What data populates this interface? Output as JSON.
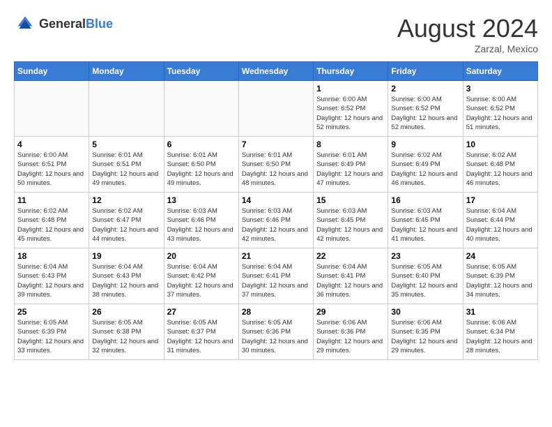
{
  "header": {
    "logo_general": "General",
    "logo_blue": "Blue",
    "month_year": "August 2024",
    "location": "Zarzal, Mexico"
  },
  "days_of_week": [
    "Sunday",
    "Monday",
    "Tuesday",
    "Wednesday",
    "Thursday",
    "Friday",
    "Saturday"
  ],
  "weeks": [
    [
      {
        "day": "",
        "empty": true
      },
      {
        "day": "",
        "empty": true
      },
      {
        "day": "",
        "empty": true
      },
      {
        "day": "",
        "empty": true
      },
      {
        "day": "1",
        "sunrise": "6:00 AM",
        "sunset": "6:52 PM",
        "daylight": "12 hours and 52 minutes."
      },
      {
        "day": "2",
        "sunrise": "6:00 AM",
        "sunset": "6:52 PM",
        "daylight": "12 hours and 52 minutes."
      },
      {
        "day": "3",
        "sunrise": "6:00 AM",
        "sunset": "6:52 PM",
        "daylight": "12 hours and 51 minutes."
      }
    ],
    [
      {
        "day": "4",
        "sunrise": "6:00 AM",
        "sunset": "6:51 PM",
        "daylight": "12 hours and 50 minutes."
      },
      {
        "day": "5",
        "sunrise": "6:01 AM",
        "sunset": "6:51 PM",
        "daylight": "12 hours and 49 minutes."
      },
      {
        "day": "6",
        "sunrise": "6:01 AM",
        "sunset": "6:50 PM",
        "daylight": "12 hours and 49 minutes."
      },
      {
        "day": "7",
        "sunrise": "6:01 AM",
        "sunset": "6:50 PM",
        "daylight": "12 hours and 48 minutes."
      },
      {
        "day": "8",
        "sunrise": "6:01 AM",
        "sunset": "6:49 PM",
        "daylight": "12 hours and 47 minutes."
      },
      {
        "day": "9",
        "sunrise": "6:02 AM",
        "sunset": "6:49 PM",
        "daylight": "12 hours and 46 minutes."
      },
      {
        "day": "10",
        "sunrise": "6:02 AM",
        "sunset": "6:48 PM",
        "daylight": "12 hours and 46 minutes."
      }
    ],
    [
      {
        "day": "11",
        "sunrise": "6:02 AM",
        "sunset": "6:48 PM",
        "daylight": "12 hours and 45 minutes."
      },
      {
        "day": "12",
        "sunrise": "6:02 AM",
        "sunset": "6:47 PM",
        "daylight": "12 hours and 44 minutes."
      },
      {
        "day": "13",
        "sunrise": "6:03 AM",
        "sunset": "6:46 PM",
        "daylight": "12 hours and 43 minutes."
      },
      {
        "day": "14",
        "sunrise": "6:03 AM",
        "sunset": "6:46 PM",
        "daylight": "12 hours and 42 minutes."
      },
      {
        "day": "15",
        "sunrise": "6:03 AM",
        "sunset": "6:45 PM",
        "daylight": "12 hours and 42 minutes."
      },
      {
        "day": "16",
        "sunrise": "6:03 AM",
        "sunset": "6:45 PM",
        "daylight": "12 hours and 41 minutes."
      },
      {
        "day": "17",
        "sunrise": "6:04 AM",
        "sunset": "6:44 PM",
        "daylight": "12 hours and 40 minutes."
      }
    ],
    [
      {
        "day": "18",
        "sunrise": "6:04 AM",
        "sunset": "6:43 PM",
        "daylight": "12 hours and 39 minutes."
      },
      {
        "day": "19",
        "sunrise": "6:04 AM",
        "sunset": "6:43 PM",
        "daylight": "12 hours and 38 minutes."
      },
      {
        "day": "20",
        "sunrise": "6:04 AM",
        "sunset": "6:42 PM",
        "daylight": "12 hours and 37 minutes."
      },
      {
        "day": "21",
        "sunrise": "6:04 AM",
        "sunset": "6:41 PM",
        "daylight": "12 hours and 37 minutes."
      },
      {
        "day": "22",
        "sunrise": "6:04 AM",
        "sunset": "6:41 PM",
        "daylight": "12 hours and 36 minutes."
      },
      {
        "day": "23",
        "sunrise": "6:05 AM",
        "sunset": "6:40 PM",
        "daylight": "12 hours and 35 minutes."
      },
      {
        "day": "24",
        "sunrise": "6:05 AM",
        "sunset": "6:39 PM",
        "daylight": "12 hours and 34 minutes."
      }
    ],
    [
      {
        "day": "25",
        "sunrise": "6:05 AM",
        "sunset": "6:39 PM",
        "daylight": "12 hours and 33 minutes."
      },
      {
        "day": "26",
        "sunrise": "6:05 AM",
        "sunset": "6:38 PM",
        "daylight": "12 hours and 32 minutes."
      },
      {
        "day": "27",
        "sunrise": "6:05 AM",
        "sunset": "6:37 PM",
        "daylight": "12 hours and 31 minutes."
      },
      {
        "day": "28",
        "sunrise": "6:05 AM",
        "sunset": "6:36 PM",
        "daylight": "12 hours and 30 minutes."
      },
      {
        "day": "29",
        "sunrise": "6:06 AM",
        "sunset": "6:36 PM",
        "daylight": "12 hours and 29 minutes."
      },
      {
        "day": "30",
        "sunrise": "6:06 AM",
        "sunset": "6:35 PM",
        "daylight": "12 hours and 29 minutes."
      },
      {
        "day": "31",
        "sunrise": "6:06 AM",
        "sunset": "6:34 PM",
        "daylight": "12 hours and 28 minutes."
      }
    ]
  ]
}
